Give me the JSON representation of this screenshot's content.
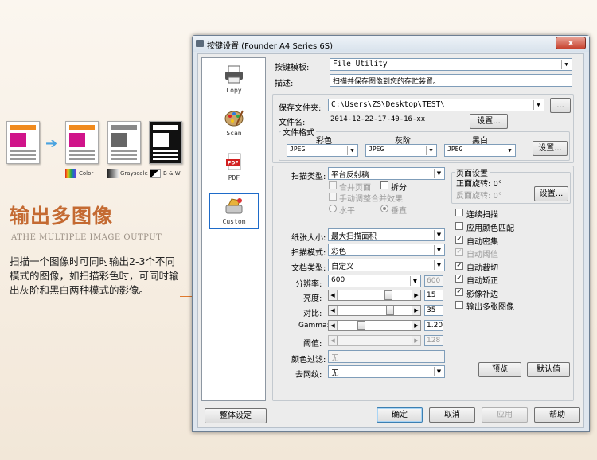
{
  "promo": {
    "title": "输出多图像",
    "subtitle": "ATHE MULTIPLE IMAGE OUTPUT",
    "body": "扫描一个图像时可同时输出2-3个不同模式的图像，如扫描彩色时，可同时输出灰阶和黑白两种模式的影像。",
    "legend_color": "Color",
    "legend_grayscale": "Grayscale",
    "legend_bw": "B & W"
  },
  "window": {
    "title": "按键设置 (Founder A4 Series 6S)",
    "close": "x"
  },
  "sidebar": {
    "items": [
      {
        "label": "Copy"
      },
      {
        "label": "Scan"
      },
      {
        "label": "PDF"
      },
      {
        "label": "Custom"
      }
    ]
  },
  "top": {
    "template_label": "按键模板:",
    "template_value": "File Utility",
    "desc_label": "描述:",
    "desc_value": "扫描并保存图像到您的存贮装置。"
  },
  "file": {
    "save_folder_label": "保存文件夹:",
    "save_folder_value": "C:\\Users\\ZS\\Desktop\\TEST\\",
    "browse": "...",
    "filename_label": "文件名:",
    "filename_value": "2014-12-22-17-40-16-xx",
    "settings_btn": "设置...",
    "format_group": "文件格式",
    "color_label": "彩色",
    "gray_label": "灰阶",
    "bw_label": "黑白",
    "color_value": "JPEG",
    "gray_value": "JPEG",
    "bw_value": "JPEG",
    "format_settings_btn": "设置..."
  },
  "scan": {
    "scan_type_label": "扫描类型:",
    "scan_type_value": "平台反射稿",
    "merge_pages": "合并页面",
    "split": "拆分",
    "manual_merge": "手动调整合并效果",
    "horizontal": "水平",
    "vertical": "垂直",
    "paper_size_label": "纸张大小:",
    "paper_size_value": "最大扫描面积",
    "scan_mode_label": "扫描模式:",
    "scan_mode_value": "彩色",
    "doc_type_label": "文档类型:",
    "doc_type_value": "自定义",
    "resolution_label": "分辨率:",
    "resolution_value": "600",
    "resolution_disabled_value": "600",
    "brightness_label": "亮度:",
    "brightness_value": "15",
    "contrast_label": "对比:",
    "contrast_value": "35",
    "gamma_label": "Gamma:",
    "gamma_value": "1.20",
    "threshold_label": "阈值:",
    "threshold_value": "128",
    "color_filter_label": "颜色过滤:",
    "color_filter_value": "无",
    "descreen_label": "去网纹:",
    "descreen_value": "无"
  },
  "page_settings": {
    "group": "页面设置",
    "front_rotate": "正面旋转: 0°",
    "back_rotate": "反面旋转: 0°",
    "settings_btn": "设置..."
  },
  "options": [
    {
      "label": "连续扫描",
      "checked": false,
      "disabled": false
    },
    {
      "label": "应用颜色匹配",
      "checked": false,
      "disabled": false
    },
    {
      "label": "自动密集",
      "checked": true,
      "disabled": false
    },
    {
      "label": "自动阈值",
      "checked": true,
      "disabled": true
    },
    {
      "label": "自动裁切",
      "checked": true,
      "disabled": false
    },
    {
      "label": "自动矫正",
      "checked": true,
      "disabled": false
    },
    {
      "label": "影像补边",
      "checked": true,
      "disabled": false
    },
    {
      "label": "输出多张图像",
      "checked": false,
      "disabled": false
    }
  ],
  "buttons": {
    "preview": "预览",
    "defaults": "默认值",
    "global_settings": "整体设定",
    "ok": "确定",
    "cancel": "取消",
    "apply": "应用",
    "help": "帮助"
  },
  "colors": {
    "accent": "#c46a32",
    "callout": "#e07a2e",
    "selection": "#1e6bc9"
  }
}
